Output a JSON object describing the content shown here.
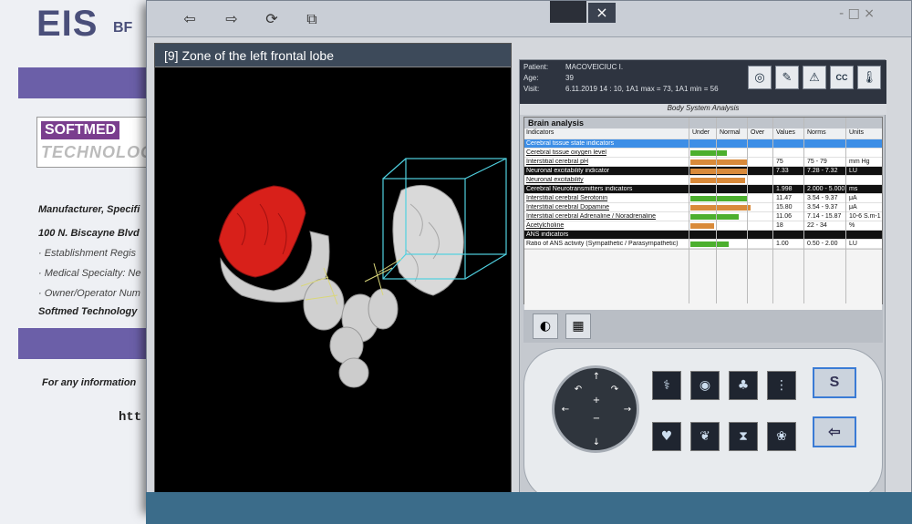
{
  "background_window": {
    "logo": "EIS",
    "logo_suffix": "BF",
    "company_logo_top": "SOFTMED",
    "company_logo_bottom": "TECHNOLOG",
    "lines": [
      "Manufacturer, Specifi",
      "100 N. Biscayne Blvd",
      "· Establishment Regis",
      "· Medical Specialty: Ne",
      "· Owner/Operator Num",
      "Softmed Technology"
    ],
    "info_line": "For any information",
    "url_fragment": "htt"
  },
  "toolbar": {
    "back_icon": "arrow-left-icon",
    "forward_icon": "arrow-right-icon",
    "refresh_icon": "refresh-icon",
    "copy_icon": "copy-icon",
    "close": "×",
    "window_controls": "- □ ×"
  },
  "view3d": {
    "title": "[9] Zone of the left frontal lobe"
  },
  "patient": {
    "name_label": "Patient:",
    "name": "MACOVEICIUC I.",
    "age_label": "Age:",
    "age": "39",
    "visit_label": "Visit:",
    "visit": "6.11.2019  14 : 10, 1A1 max = 73, 1A1 min = 56"
  },
  "section_title": "Body System Analysis",
  "table": {
    "title": "Brain analysis",
    "headers": {
      "indicators": "Indicators",
      "under": "Under",
      "normal": "Normal",
      "over": "Over",
      "values": "Values",
      "norms": "Norms",
      "units": "Units"
    },
    "rows": [
      {
        "name": "Cerebral tissue state indicators",
        "kind": "selected",
        "value": "",
        "norm": "",
        "unit": "",
        "bar_color": "",
        "bar_level": 0
      },
      {
        "name": "Cerebral  tissue oxygen level",
        "kind": "link",
        "value": "",
        "norm": "",
        "unit": "",
        "bar_color": "#4caf2e",
        "bar_level": 0.45
      },
      {
        "name": "Interstitial cerebral pH",
        "kind": "link",
        "value": "75",
        "norm": "75 - 79",
        "unit": "mm Hg",
        "bar_color": "#d98a3a",
        "bar_level": 0.7
      },
      {
        "name": "Neuronal excitability indicator",
        "kind": "section",
        "value": "7.33",
        "norm": "7.28 - 7.32",
        "unit": "LU",
        "bar_color": "#d98a3a",
        "bar_level": 0.72
      },
      {
        "name": "Neuronal excitability",
        "kind": "link",
        "value": "",
        "norm": "",
        "unit": "",
        "bar_color": "#d98a3a",
        "bar_level": 0.68
      },
      {
        "name": "Cerebral Neurotransmitters indicators",
        "kind": "section",
        "value": "1.998",
        "norm": "2.000 - 5.000",
        "unit": "ms",
        "bar_color": "",
        "bar_level": 0
      },
      {
        "name": "Interstitial cerebral Serotonin",
        "kind": "link",
        "value": "11.47",
        "norm": "3.54 - 9.37",
        "unit": "μA",
        "bar_color": "#4caf2e",
        "bar_level": 0.72
      },
      {
        "name": "Interstitial cerebral Dopamine",
        "kind": "link",
        "value": "15.80",
        "norm": "3.54 - 9.37",
        "unit": "μA",
        "bar_color": "#d98a3a",
        "bar_level": 0.75
      },
      {
        "name": "Interstitial cerebral Adrenaline / Noradrenaline",
        "kind": "link",
        "value": "11.06",
        "norm": "7.14 - 15.87",
        "unit": "10-6 S.m-1",
        "bar_color": "#4caf2e",
        "bar_level": 0.6
      },
      {
        "name": "Acetylcholine",
        "kind": "link",
        "value": "18",
        "norm": "22 - 34",
        "unit": "%",
        "bar_color": "#d98a3a",
        "bar_level": 0.3
      },
      {
        "name": "ANS indicators",
        "kind": "section",
        "value": "",
        "norm": "",
        "unit": "",
        "bar_color": "",
        "bar_level": 0
      },
      {
        "name": "Ratio of ANS activity (Sympathetic / Parasympathetic)",
        "kind": "plain",
        "value": "1.00",
        "norm": "0.50 - 2.00",
        "unit": "LU",
        "bar_color": "#4caf2e",
        "bar_level": 0.48
      }
    ]
  },
  "buttons": {
    "s_label": "S",
    "back_label": "⇦"
  },
  "colors": {
    "selected": "#3d8ee6",
    "section": "#111111",
    "brain_red": "#d8201a"
  }
}
